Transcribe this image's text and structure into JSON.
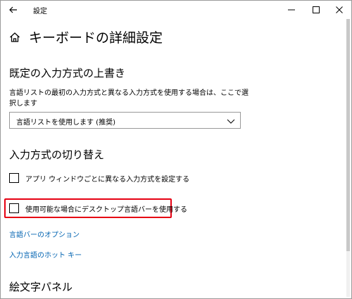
{
  "window": {
    "title": "設定"
  },
  "header": {
    "page_title": "キーボードの詳細設定"
  },
  "override_section": {
    "title": "既定の入力方式の上書き",
    "description": "言語リストの最初の入力方式と異なる入力方式を使用する場合は、ここで選択します",
    "dropdown_value": "言語リストを使用します (推奨)"
  },
  "switch_section": {
    "title": "入力方式の切り替え",
    "checkbox_per_app": {
      "label": "アプリ ウィンドウごとに異なる入力方式を設定する",
      "checked": false
    },
    "checkbox_desktop_langbar": {
      "label": "使用可能な場合にデスクトップ言語バーを使用する",
      "checked": false
    }
  },
  "links": {
    "langbar_options": "言語バーのオプション",
    "input_hotkeys": "入力言語のホット キー"
  },
  "emoji_section": {
    "title": "絵文字パネル"
  },
  "colors": {
    "link": "#0063b1",
    "highlight": "#e60012"
  }
}
